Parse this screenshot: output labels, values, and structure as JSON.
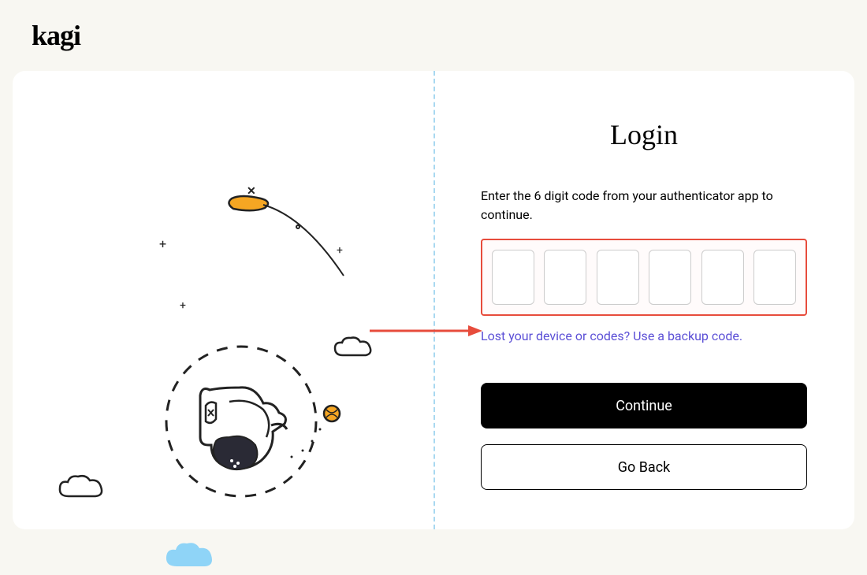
{
  "brand": {
    "name": "kagi"
  },
  "login": {
    "title": "Login",
    "instruction": "Enter the 6 digit code from your authenticator app to continue.",
    "backup_link": "Lost your device or codes? Use a backup code.",
    "continue_label": "Continue",
    "goback_label": "Go Back",
    "otp_digits": [
      "",
      "",
      "",
      "",
      "",
      ""
    ]
  },
  "annotation": {
    "arrow_color": "#e74c3c"
  }
}
